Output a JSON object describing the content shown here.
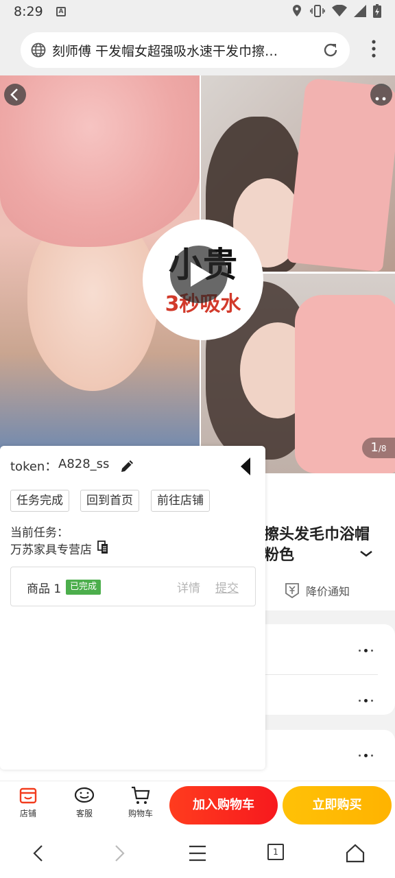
{
  "status_bar": {
    "time": "8:29",
    "notification_glyph": "A"
  },
  "browser": {
    "url_title": "刻师傅 干发帽女超强吸水速干发巾擦…"
  },
  "hero": {
    "badge_line1": "小贵",
    "badge_line2": "3秒吸水",
    "counter_current": "1",
    "counter_total": "/8"
  },
  "product": {
    "title_partial": "擦头发毛巾浴帽 粉色",
    "price_alert": "降价通知"
  },
  "helper": {
    "token_label": "token：",
    "token_value": "A828_ss",
    "btn_task_done": "任务完成",
    "btn_home": "回到首页",
    "btn_shop": "前往店铺",
    "current_task_label": "当前任务：",
    "current_task_name": "万苏家具专营店",
    "goods_name": "商品 1",
    "goods_status": "已完成",
    "goods_detail": "详情",
    "goods_submit": "提交"
  },
  "action_bar": {
    "shop": "店铺",
    "service": "客服",
    "cart": "购物车",
    "add_to_cart": "加入购物车",
    "buy_now": "立即购买"
  },
  "system_nav": {
    "tabs_count": "1"
  },
  "colors": {
    "accent_red": "#f7191e",
    "accent_yellow": "#ffb300",
    "done_green": "#4cae4c"
  }
}
